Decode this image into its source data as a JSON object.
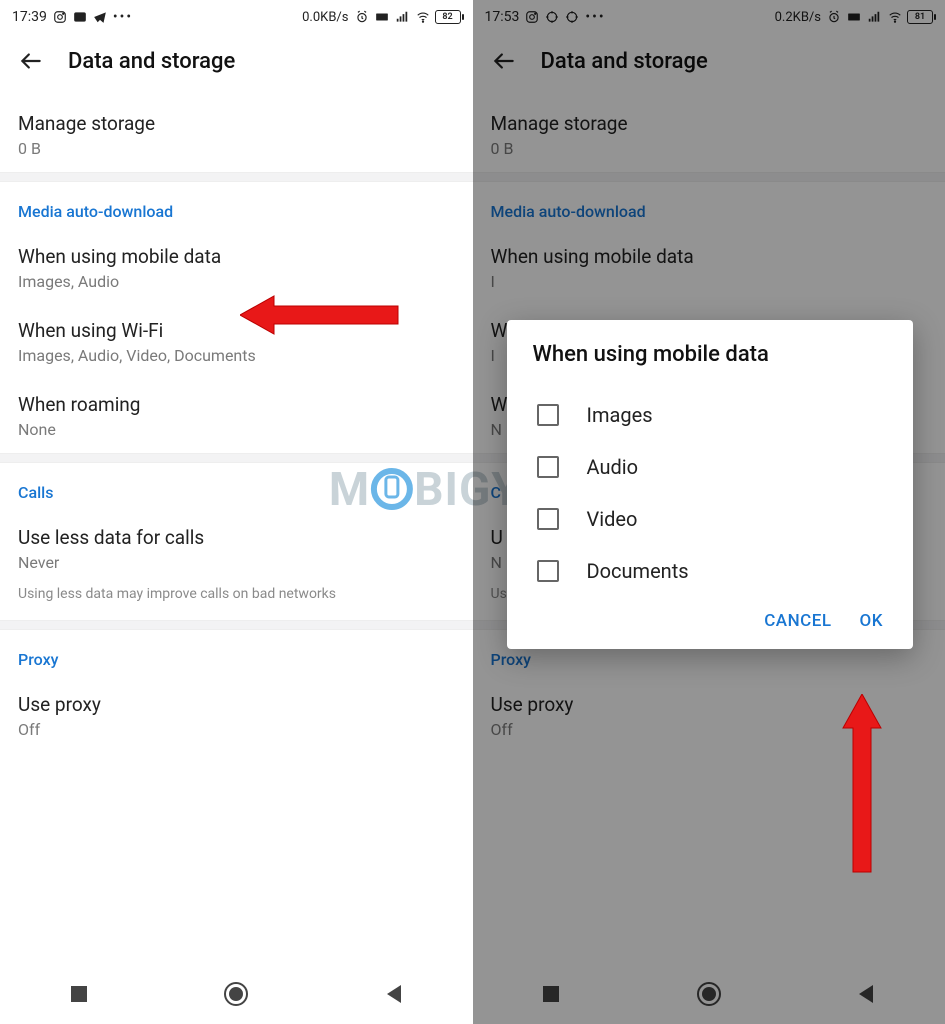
{
  "left": {
    "status": {
      "time": "17:39",
      "data": "0.0KB/s",
      "battery": "82"
    },
    "header": {
      "title": "Data and storage"
    },
    "manage": {
      "title": "Manage storage",
      "sub": "0 B"
    },
    "section_media": "Media auto-download",
    "mobile": {
      "title": "When using mobile data",
      "sub": "Images, Audio"
    },
    "wifi": {
      "title": "When using Wi-Fi",
      "sub": "Images, Audio, Video, Documents"
    },
    "roaming": {
      "title": "When roaming",
      "sub": "None"
    },
    "section_calls": "Calls",
    "lessdata": {
      "title": "Use less data for calls",
      "sub": "Never"
    },
    "hint": "Using less data may improve calls on bad networks",
    "section_proxy": "Proxy",
    "proxy": {
      "title": "Use proxy",
      "sub": "Off"
    }
  },
  "right": {
    "status": {
      "time": "17:53",
      "data": "0.2KB/s",
      "battery": "81"
    },
    "header": {
      "title": "Data and storage"
    },
    "manage": {
      "title": "Manage storage",
      "sub": "0 B"
    },
    "section_media": "Media auto-download",
    "mobile": {
      "title": "When using mobile data",
      "sub": "I"
    },
    "wifi": {
      "title": "W",
      "sub": "I"
    },
    "roaming": {
      "title": "W",
      "sub": "N"
    },
    "section_calls": "C",
    "lessdata": {
      "title": "U",
      "sub": "N"
    },
    "hint": "Using less data may improve calls on bad networks",
    "section_proxy": "Proxy",
    "proxy": {
      "title": "Use proxy",
      "sub": "Off"
    },
    "dialog": {
      "title": "When using mobile data",
      "opts": {
        "0": "Images",
        "1": "Audio",
        "2": "Video",
        "3": "Documents"
      },
      "cancel": "CANCEL",
      "ok": "OK"
    }
  },
  "watermark": {
    "pre": "M",
    "post": "BIGYAAN"
  }
}
